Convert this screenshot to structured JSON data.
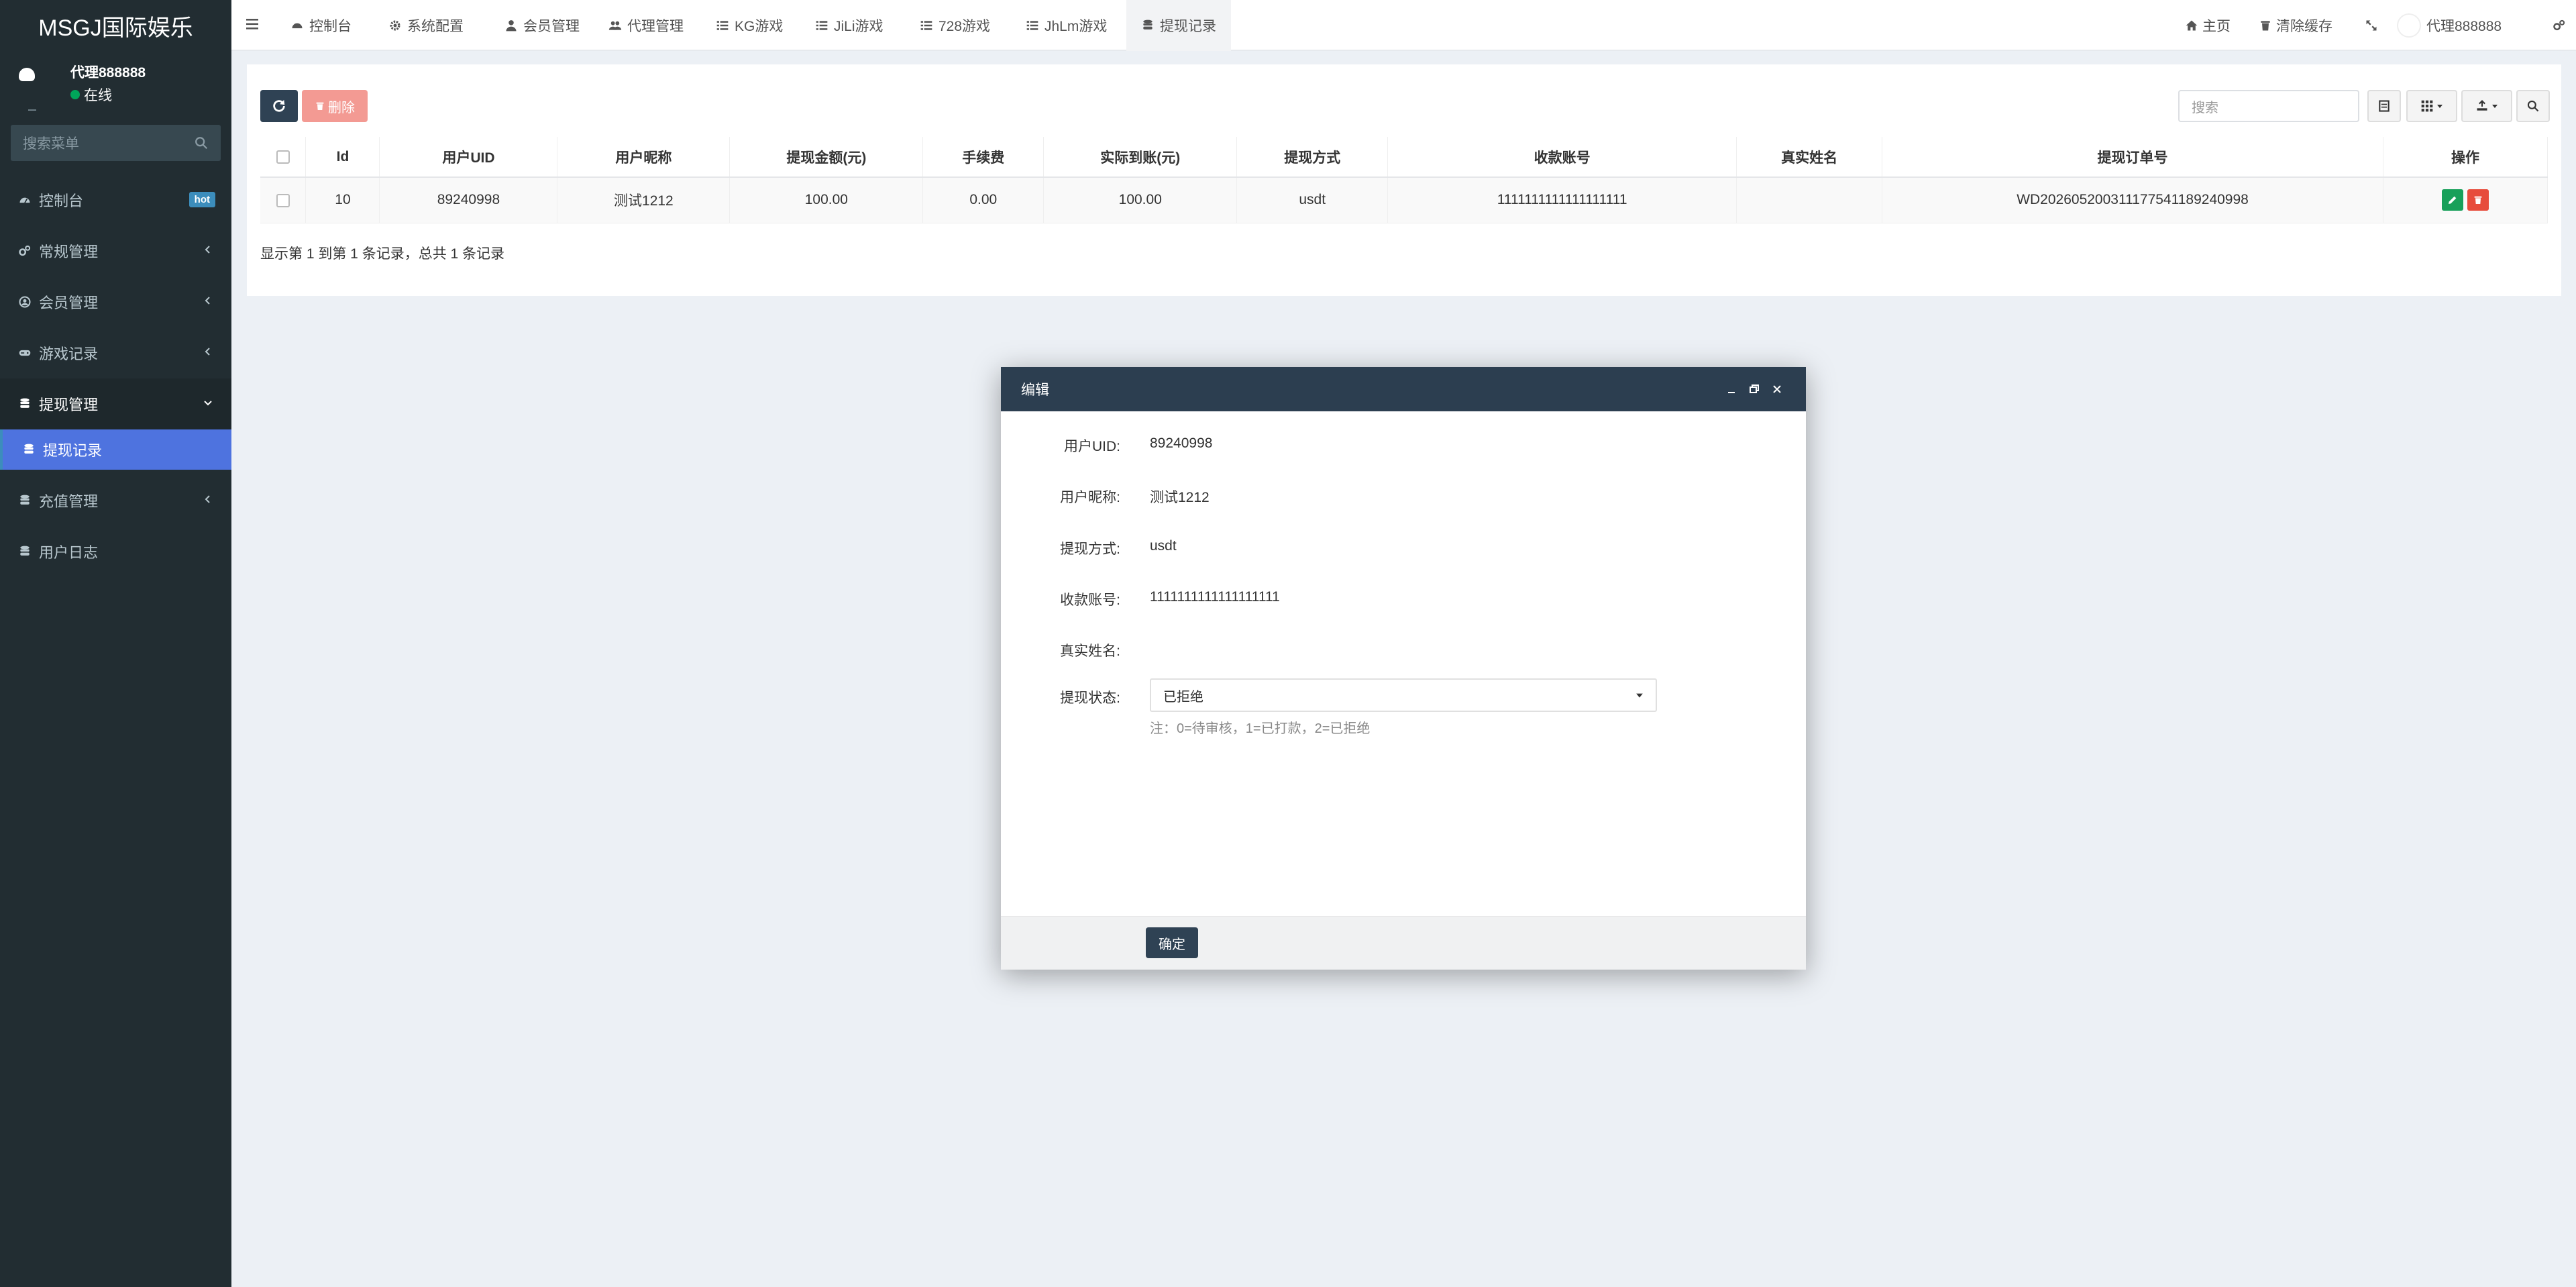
{
  "brand": "MSGJ国际娱乐",
  "user": {
    "name": "代理888888",
    "status": "在线"
  },
  "sidebar": {
    "search_placeholder": "搜索菜单",
    "items": [
      {
        "label": "控制台",
        "badge": "hot",
        "icon": "dashboard-icon"
      },
      {
        "label": "常规管理",
        "icon": "cogs-icon"
      },
      {
        "label": "会员管理",
        "icon": "user-circle-icon"
      },
      {
        "label": "游戏记录",
        "icon": "gamepad-icon"
      },
      {
        "label": "提现管理",
        "icon": "database-icon"
      },
      {
        "label": "提现记录",
        "icon": "database-icon"
      },
      {
        "label": "充值管理",
        "icon": "database-icon"
      },
      {
        "label": "用户日志",
        "icon": "database-icon"
      }
    ]
  },
  "topnav": {
    "tabs": [
      "控制台",
      "系统配置",
      "会员管理",
      "代理管理",
      "KG游戏",
      "JiLi游戏",
      "728游戏",
      "JhLm游戏",
      "提现记录"
    ],
    "right": {
      "home": "主页",
      "clear_cache": "清除缓存",
      "user": "代理888888"
    }
  },
  "toolbar": {
    "delete_label": "删除",
    "search_placeholder": "搜索"
  },
  "table": {
    "headers": [
      "Id",
      "用户UID",
      "用户昵称",
      "提现金额(元)",
      "手续费",
      "实际到账(元)",
      "提现方式",
      "收款账号",
      "真实姓名",
      "提现订单号",
      "操作"
    ],
    "rows": [
      {
        "id": "10",
        "uid": "89240998",
        "nickname": "测试1212",
        "amount": "100.00",
        "fee": "0.00",
        "actual": "100.00",
        "method": "usdt",
        "account": "1111111111111111111",
        "realname": "",
        "order": "WD202605200311177541189240998"
      }
    ]
  },
  "pager": "显示第 1 到第 1 条记录，总共 1 条记录",
  "modal": {
    "title": "编辑",
    "fields": {
      "uid_label": "用户UID:",
      "uid": "89240998",
      "nick_label": "用户昵称:",
      "nick": "测试1212",
      "method_label": "提现方式:",
      "method": "usdt",
      "account_label": "收款账号:",
      "account": "1111111111111111111",
      "realname_label": "真实姓名:",
      "realname": "",
      "status_label": "提现状态:",
      "status": "已拒绝",
      "hint": "注：0=待审核，1=已打款，2=已拒绝"
    },
    "ok": "确定"
  }
}
